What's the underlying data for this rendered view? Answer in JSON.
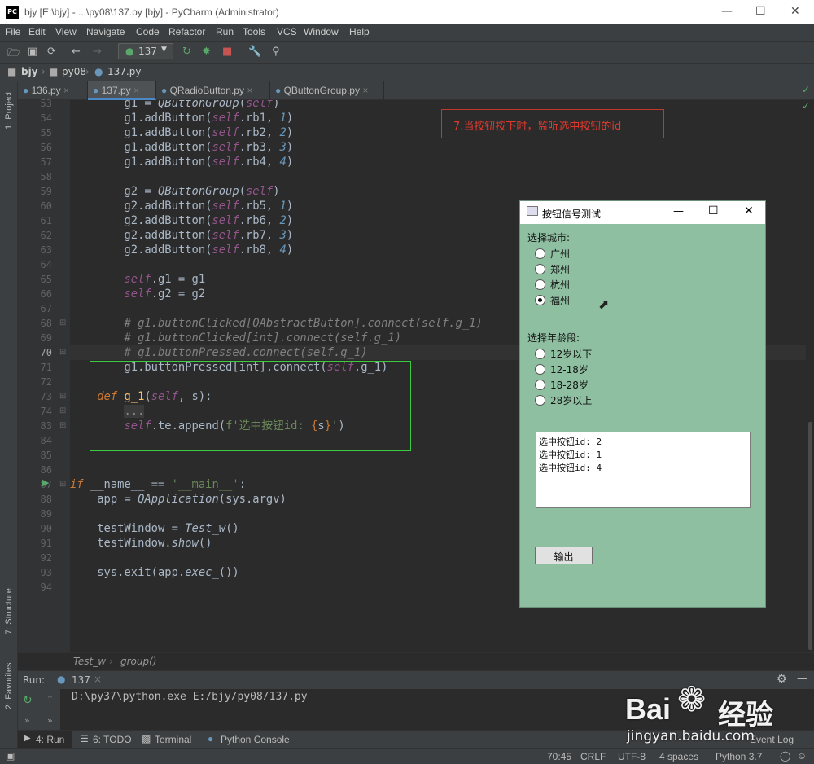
{
  "window": {
    "title": "bjy [E:\\bjy] - ...\\py08\\137.py [bjy] - PyCharm (Administrator)",
    "logo": "PC"
  },
  "menu": [
    "File",
    "Edit",
    "View",
    "Navigate",
    "Code",
    "Refactor",
    "Run",
    "Tools",
    "VCS",
    "Window",
    "Help"
  ],
  "toolbar": {
    "run_config": "137"
  },
  "navbar": {
    "project": "bjy",
    "folder": "py08",
    "file": "137.py"
  },
  "side_tabs": {
    "project": "1: Project",
    "structure": "7: Structure",
    "favorites": "2: Favorites"
  },
  "tabs": [
    {
      "label": "136.py",
      "active": false
    },
    {
      "label": "137.py",
      "active": true
    },
    {
      "label": "QRadioButton.py",
      "active": false
    },
    {
      "label": "QButtonGroup.py",
      "active": false
    }
  ],
  "line_numbers": [
    "53",
    "54",
    "55",
    "56",
    "57",
    "58",
    "59",
    "60",
    "61",
    "62",
    "63",
    "64",
    "65",
    "66",
    "67",
    "68",
    "69",
    "70",
    "71",
    "72",
    "73",
    "74",
    "83",
    "84",
    "85",
    "86",
    "87",
    "88",
    "89",
    "90",
    "91",
    "92",
    "93",
    "94"
  ],
  "annotation": "7.当按钮按下时，监听选中按钮的id",
  "breadcrumb": {
    "class": "Test_w",
    "method": "group()"
  },
  "run_panel": {
    "label": "Run:",
    "tab": "137",
    "output": "D:\\py37\\python.exe E:/bjy/py08/137.py"
  },
  "bottom_tabs": [
    "4: Run",
    "6: TODO",
    "Terminal",
    "Python Console"
  ],
  "status": {
    "position": "70:45",
    "line_sep": "CRLF",
    "encoding": "UTF-8",
    "indent": "4 spaces",
    "interpreter": "Python 3.7",
    "event_log": "Event Log"
  },
  "qt_window": {
    "title": "按钮信号测试",
    "city_label": "选择城市:",
    "cities": [
      "广州",
      "郑州",
      "杭州",
      "福州"
    ],
    "city_selected": 3,
    "age_label": "选择年龄段:",
    "ages": [
      "12岁以下",
      "12-18岁",
      "18-28岁",
      "28岁以上"
    ],
    "age_selected": -1,
    "output_lines": [
      "选中按钮id: 2",
      "选中按钮id: 1",
      "选中按钮id: 4"
    ],
    "button": "输出"
  },
  "watermark": {
    "brand": "Bai",
    "brand2": "经验",
    "url": "jingyan.baidu.com"
  },
  "colors": {
    "annotation_border": "#c0392b",
    "highlight_box": "#3dcc3d",
    "qt_bg": "#8fbfa1"
  }
}
